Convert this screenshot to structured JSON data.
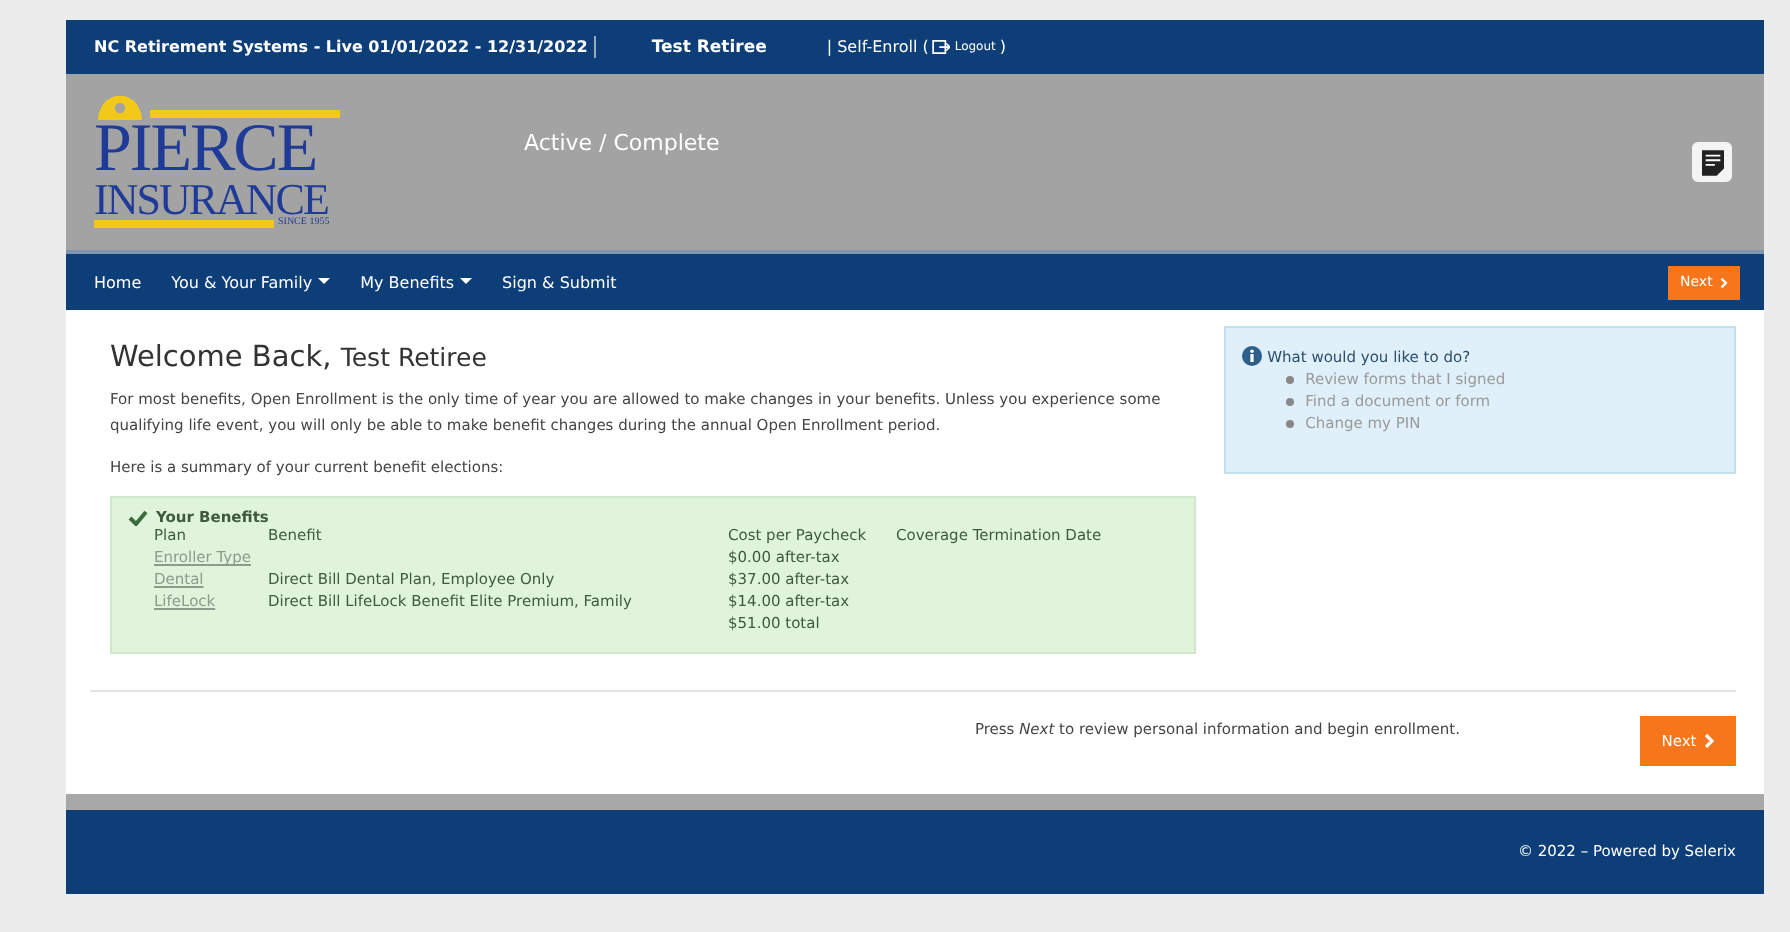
{
  "top_bar": {
    "system": "NC Retirement Systems - Live 01/01/2022 - 12/31/2022",
    "user": "Test Retiree",
    "mode": "| Self-Enroll (",
    "logout": "Logout",
    "close": ")"
  },
  "logo": {
    "line1": "PIERCE",
    "line2": "INSURANCE",
    "since": "SINCE 1955"
  },
  "status": "Active / Complete",
  "nav": [
    {
      "label": "Home",
      "dropdown": false
    },
    {
      "label": "You & Your Family",
      "dropdown": true
    },
    {
      "label": "My Benefits",
      "dropdown": true
    },
    {
      "label": "Sign & Submit",
      "dropdown": false
    }
  ],
  "nav_next": "Next",
  "welcome": {
    "prefix": "Welcome Back,",
    "name": "Test Retiree"
  },
  "intro": "For most benefits, Open Enrollment is the only time of year you are allowed to make changes in your benefits. Unless you experience some qualifying life event, you will only be able to make benefit changes during the annual Open Enrollment period.",
  "summary_label": "Here is a summary of your current benefit elections:",
  "benefits": {
    "title": "Your Benefits",
    "columns": [
      "Plan",
      "Benefit",
      "Cost per Paycheck",
      "Coverage Termination Date"
    ],
    "rows": [
      {
        "plan": "Enroller Type",
        "benefit": "",
        "cost": "$0.00 after-tax"
      },
      {
        "plan": "Dental",
        "benefit": "Direct Bill Dental Plan, Employee Only",
        "cost": "$37.00 after-tax"
      },
      {
        "plan": "LifeLock",
        "benefit": "Direct Bill LifeLock Benefit Elite Premium, Family",
        "cost": "$14.00 after-tax"
      }
    ],
    "total": "$51.00 total"
  },
  "help": {
    "title": "What would you like to do?",
    "links": [
      "Review forms that I signed",
      "Find a document or form",
      "Change my PIN"
    ]
  },
  "footer_note": "Press *Next* to review personal information and begin enrollment.",
  "next": "Next",
  "copyright": "© 2022 – Powered by Selerix"
}
